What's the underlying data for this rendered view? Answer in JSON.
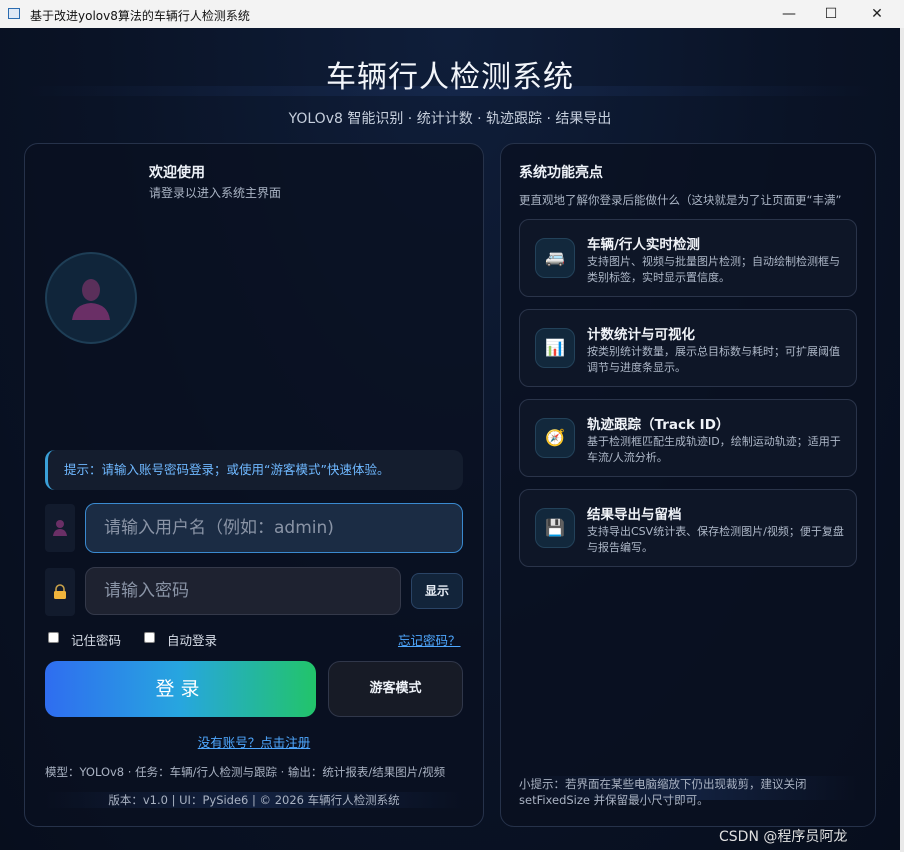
{
  "window": {
    "title": "基于改进yolov8算法的车辆行人检测系统",
    "minimize": "—",
    "maximize": "☐",
    "close": "✕"
  },
  "header": {
    "title": "车辆行人检测系统",
    "subtitle": "YOLOv8 智能识别 · 统计计数 · 轨迹跟踪 · 结果导出"
  },
  "login": {
    "welcome_title": "欢迎使用",
    "welcome_sub": "请登录以进入系统主界面",
    "hint": "提示：请输入账号密码登录；或使用“游客模式”快速体验。",
    "username_placeholder": "请输入用户名（例如：admin)",
    "password_placeholder": "请输入密码",
    "show_label": "显示",
    "remember_label": "记住密码",
    "auto_login_label": "自动登录",
    "forgot_label": "忘记密码？",
    "login_label": "登录",
    "guest_label": "游客模式",
    "register_label": "没有账号？点击注册",
    "model_line": "模型：YOLOv8 · 任务：车辆/行人检测与跟踪 · 输出：统计报表/结果图片/视频",
    "version_line": "版本：v1.0  |  UI：PySide6  |  © 2026 车辆行人检测系统"
  },
  "features": {
    "title": "系统功能亮点",
    "subtitle": "更直观地了解你登录后能做什么（这块就是为了让页面更“丰满”",
    "cards": [
      {
        "icon": "🚐",
        "title": "车辆/行人实时检测",
        "desc": "支持图片、视频与批量图片检测；自动绘制检测框与类别标签，实时显示置信度。"
      },
      {
        "icon": "📊",
        "title": "计数统计与可视化",
        "desc": "按类别统计数量，展示总目标数与耗时；可扩展阈值调节与进度条显示。"
      },
      {
        "icon": "🧭",
        "title": "轨迹跟踪（Track ID）",
        "desc": "基于检测框匹配生成轨迹ID，绘制运动轨迹；适用于车流/人流分析。"
      },
      {
        "icon": "💾",
        "title": "结果导出与留档",
        "desc": "支持导出CSV统计表、保存检测图片/视频；便于复盘与报告编写。"
      }
    ],
    "tip": "小提示：若界面在某些电脑缩放下仍出现裁剪，建议关闭 setFixedSize 并保留最小尺寸即可。"
  },
  "watermark": "CSDN @程序员阿龙",
  "colors": {
    "accent": "#3a8ad0",
    "link": "#4fa8ff",
    "login_gradient_start": "#2f6df0",
    "login_gradient_end": "#22c46a"
  }
}
